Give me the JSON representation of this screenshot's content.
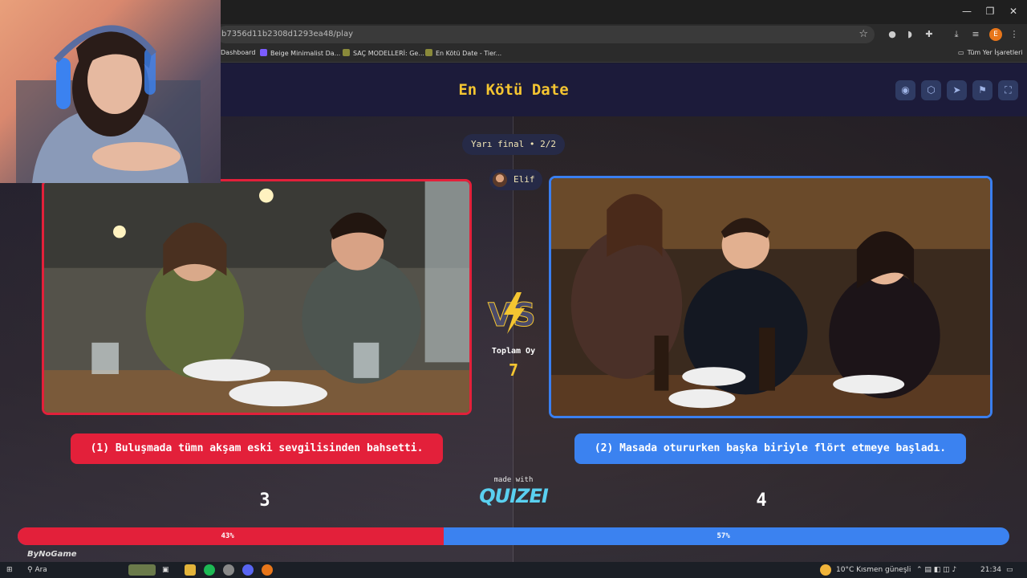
{
  "browser": {
    "url": "b7356d11b2308d1293ea48/play",
    "window_controls": [
      "—",
      "❐",
      "✕"
    ],
    "profile_initial": "E",
    "bookmarks": [
      {
        "label": "Dashboard",
        "color": "#666"
      },
      {
        "label": "Beige Minimalist Da...",
        "color": "#7b5cff"
      },
      {
        "label": "SAÇ MODELLERİ: Ge...",
        "color": "#8a8a3a"
      },
      {
        "label": "En Kötü Date - Tier...",
        "color": "#8a8a3a"
      }
    ],
    "all_bookmarks": "Tüm Yer İşaretleri"
  },
  "app": {
    "title": "En Kötü Date",
    "round": "Yarı final • 2/2",
    "user": "Elif",
    "total_label": "Toplam Oy",
    "total_votes": "7",
    "made_with": "made with",
    "brand": "QUIZEI",
    "watermark": "ByNoGame",
    "options": [
      {
        "label": "(1) Buluşmada tümn akşam eski sevgilisinden bahsetti.",
        "votes": "3",
        "percent_label": "43%",
        "percent": 43,
        "color": "#e3203a"
      },
      {
        "label": "(2) Masada otururken başka biriyle flört etmeye başladı.",
        "votes": "4",
        "percent_label": "57%",
        "percent": 57,
        "color": "#3b82f0"
      }
    ],
    "accent": "#f4c531"
  },
  "taskbar": {
    "search": "Ara",
    "weather": "10°C  Kısmen güneşli",
    "time": "21:34"
  }
}
